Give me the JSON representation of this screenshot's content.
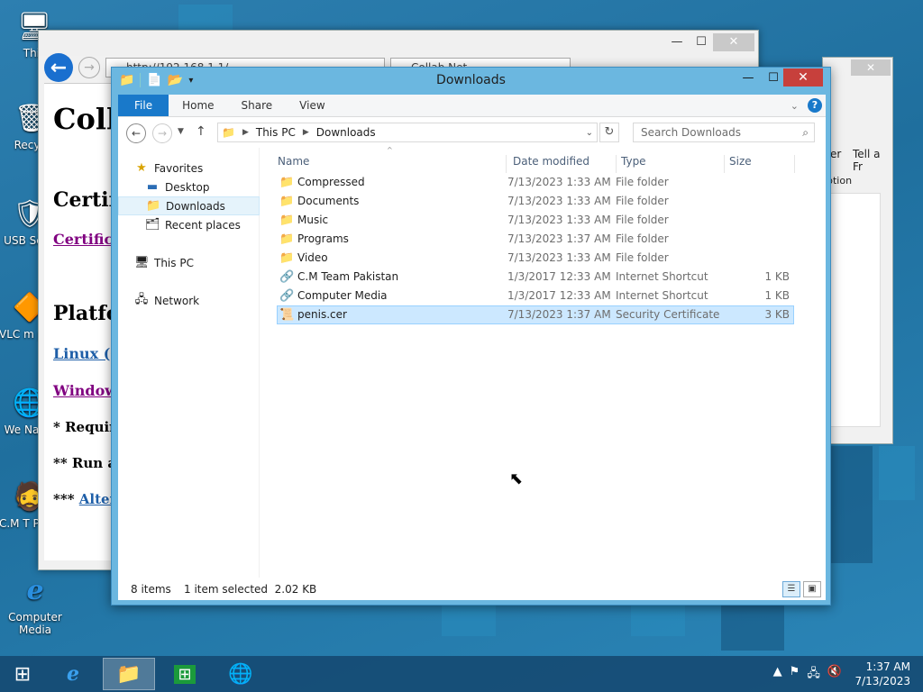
{
  "desktop": {
    "icons": [
      {
        "label": "This",
        "glyph": "🖥"
      },
      {
        "label": "Recycl",
        "glyph": "🗑"
      },
      {
        "label": "USB Secu",
        "glyph": "🛡"
      },
      {
        "label": "VLC m play",
        "glyph": "🔶"
      },
      {
        "label": "We Navig",
        "glyph": "🌐"
      },
      {
        "label": "C.M T Pakis",
        "glyph": "🧔"
      },
      {
        "label": "Computer Media",
        "glyph": "ℯ"
      }
    ]
  },
  "browser": {
    "address": "http://192.168.1.1/",
    "tab_title": "Collab.Net",
    "page_h1": "Colla",
    "page_h2a": "Certifi",
    "page_link1": "Certifica",
    "page_h2b": "Platfor",
    "page_link2": "Linux (s",
    "page_link3": "Window",
    "page_text1": "* Require",
    "page_text2": "** Run as",
    "page_text3_prefix": "***",
    "page_text3_link": "Alter"
  },
  "bg_window2": {
    "text1": "er",
    "text2": "Tell a Fr",
    "text3": "ption"
  },
  "explorer": {
    "title": "Downloads",
    "ribbon_tabs": {
      "file": "File",
      "home": "Home",
      "share": "Share",
      "view": "View"
    },
    "breadcrumb": {
      "root": "This PC",
      "current": "Downloads"
    },
    "search_placeholder": "Search Downloads",
    "nav": {
      "favorites": "Favorites",
      "desktop": "Desktop",
      "downloads": "Downloads",
      "recent": "Recent places",
      "thispc": "This PC",
      "network": "Network"
    },
    "columns": {
      "name": "Name",
      "date": "Date modified",
      "type": "Type",
      "size": "Size"
    },
    "files": [
      {
        "name": "Compressed",
        "date": "7/13/2023 1:33 AM",
        "type": "File folder",
        "size": "",
        "icon": "folder-icon"
      },
      {
        "name": "Documents",
        "date": "7/13/2023 1:33 AM",
        "type": "File folder",
        "size": "",
        "icon": "folder-icon"
      },
      {
        "name": "Music",
        "date": "7/13/2023 1:33 AM",
        "type": "File folder",
        "size": "",
        "icon": "folder-icon"
      },
      {
        "name": "Programs",
        "date": "7/13/2023 1:37 AM",
        "type": "File folder",
        "size": "",
        "icon": "folder-icon"
      },
      {
        "name": "Video",
        "date": "7/13/2023 1:33 AM",
        "type": "File folder",
        "size": "",
        "icon": "folder-icon"
      },
      {
        "name": "C.M Team Pakistan",
        "date": "1/3/2017 12:33 AM",
        "type": "Internet Shortcut",
        "size": "1 KB",
        "icon": "shortcut-icon"
      },
      {
        "name": "Computer Media",
        "date": "1/3/2017 12:33 AM",
        "type": "Internet Shortcut",
        "size": "1 KB",
        "icon": "shortcut-icon"
      },
      {
        "name": "penis.cer",
        "date": "7/13/2023 1:37 AM",
        "type": "Security Certificate",
        "size": "3 KB",
        "icon": "certificate-icon",
        "selected": true
      }
    ],
    "status": {
      "count": "8 items",
      "selection": "1 item selected  2.02 KB"
    }
  },
  "taskbar": {
    "time": "1:37 AM",
    "date": "7/13/2023"
  },
  "colors": {
    "accent": "#1979ca",
    "selection": "#cce8ff",
    "close": "#c7403c",
    "titlebar": "#6bb7e0"
  }
}
